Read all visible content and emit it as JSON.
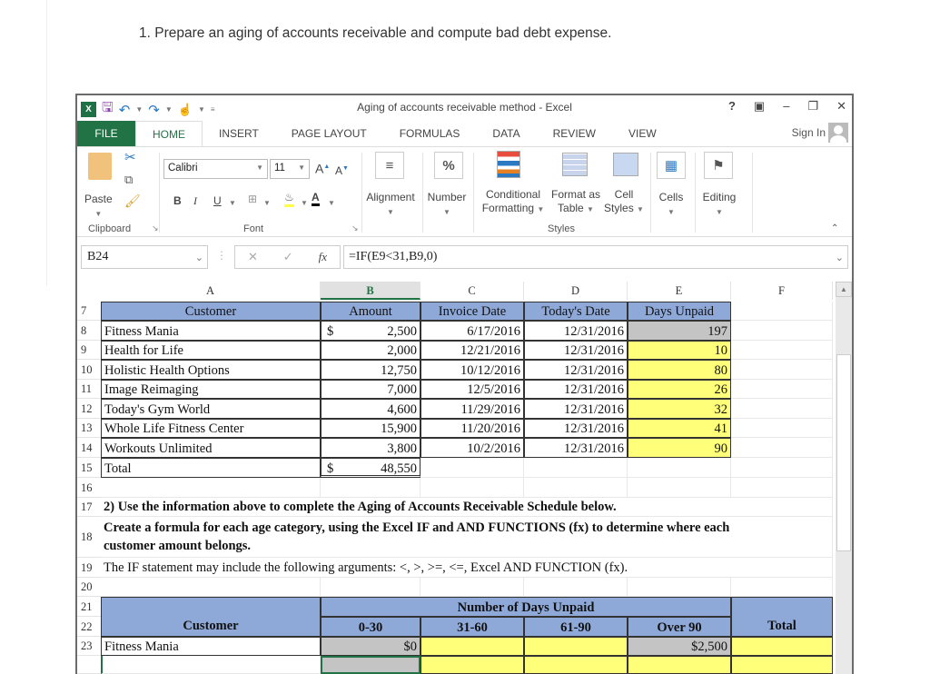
{
  "question": "1. Prepare an aging of accounts receivable and compute bad debt expense.",
  "window": {
    "title": "Aging of accounts receivable method - Excel",
    "controls": [
      "?",
      "ribbon-display",
      "minimize",
      "restore",
      "close"
    ],
    "sign_in": "Sign In"
  },
  "tabs": [
    "FILE",
    "HOME",
    "INSERT",
    "PAGE LAYOUT",
    "FORMULAS",
    "DATA",
    "REVIEW",
    "VIEW"
  ],
  "active_tab": "HOME",
  "ribbon": {
    "clipboard": {
      "paste": "Paste",
      "label": "Clipboard"
    },
    "font": {
      "name": "Calibri",
      "size": "11",
      "bold": "B",
      "italic": "I",
      "underline": "U",
      "label": "Font"
    },
    "alignment": "Alignment",
    "number": "Number",
    "styles": {
      "conditional_1": "Conditional",
      "conditional_2": "Formatting",
      "format_table_1": "Format as",
      "format_table_2": "Table",
      "cell_styles_1": "Cell",
      "cell_styles_2": "Styles",
      "label": "Styles"
    },
    "cells": "Cells",
    "editing": "Editing"
  },
  "formula_bar": {
    "name_box": "B24",
    "formula": "=IF(E9<31,B9,0)"
  },
  "columns": [
    "A",
    "B",
    "C",
    "D",
    "E",
    "F"
  ],
  "selected_column": "B",
  "table1": {
    "headers": [
      "Customer",
      "Amount",
      "Invoice Date",
      "Today's Date",
      "Days Unpaid"
    ],
    "rows": [
      {
        "row": "8",
        "customer": "Fitness Mania",
        "dollar": "$",
        "amount": "2,500",
        "invoice": "6/17/2016",
        "today": "12/31/2016",
        "days": "197"
      },
      {
        "row": "9",
        "customer": "Health for Life",
        "dollar": "",
        "amount": "2,000",
        "invoice": "12/21/2016",
        "today": "12/31/2016",
        "days": "10"
      },
      {
        "row": "10",
        "customer": "Holistic Health Options",
        "dollar": "",
        "amount": "12,750",
        "invoice": "10/12/2016",
        "today": "12/31/2016",
        "days": "80"
      },
      {
        "row": "11",
        "customer": "Image Reimaging",
        "dollar": "",
        "amount": "7,000",
        "invoice": "12/5/2016",
        "today": "12/31/2016",
        "days": "26"
      },
      {
        "row": "12",
        "customer": "Today's Gym World",
        "dollar": "",
        "amount": "4,600",
        "invoice": "11/29/2016",
        "today": "12/31/2016",
        "days": "32"
      },
      {
        "row": "13",
        "customer": "Whole Life Fitness Center",
        "dollar": "",
        "amount": "15,900",
        "invoice": "11/20/2016",
        "today": "12/31/2016",
        "days": "41"
      },
      {
        "row": "14",
        "customer": "Workouts Unlimited",
        "dollar": "",
        "amount": "3,800",
        "invoice": "10/2/2016",
        "today": "12/31/2016",
        "days": "90"
      }
    ],
    "total": {
      "row": "15",
      "label": "Total",
      "dollar": "$",
      "amount": "48,550"
    }
  },
  "instructions": {
    "r17": "2) Use the information above to complete the Aging of Accounts Receivable Schedule below.",
    "r18a": "Create a formula for each age category, using the Excel IF and AND FUNCTIONS (fx) to determine where each",
    "r18b": "customer amount belongs.",
    "r19": "The IF statement may include the following arguments:  <, >, >=, <=, Excel AND FUNCTION (fx)."
  },
  "schedule": {
    "group_header": "Number of Days Unpaid",
    "customer_header": "Customer",
    "buckets": [
      "0-30",
      "31-60",
      "61-90",
      "Over 90"
    ],
    "total_header": "Total",
    "rows": [
      {
        "row": "23",
        "customer": "Fitness Mania",
        "values": [
          "$0",
          "",
          "",
          "$2,500"
        ],
        "total": ""
      }
    ]
  },
  "colors": {
    "excel_green": "#217346",
    "header_blue": "#8ea9d8",
    "input_yellow": "#ffff7a",
    "answer_gray": "#c4c4c4"
  }
}
